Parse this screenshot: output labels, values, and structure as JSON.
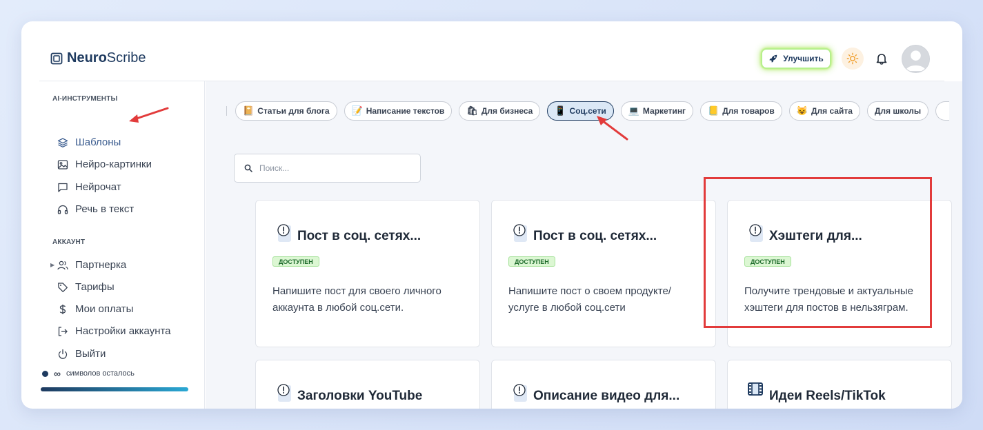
{
  "logo": {
    "bold": "Neuro",
    "rest": "Scribe"
  },
  "header": {
    "upgrade_label": "Улучшить",
    "glow_color": "#b6f08c"
  },
  "sidebar": {
    "section_tools": "AI-ИНСТРУМЕНТЫ",
    "tools": [
      {
        "label": "Шаблоны",
        "icon": "layers-icon",
        "active": true
      },
      {
        "label": "Нейро-картинки",
        "icon": "image-icon"
      },
      {
        "label": "Нейрочат",
        "icon": "chat-icon"
      },
      {
        "label": "Речь в текст",
        "icon": "headphones-icon"
      }
    ],
    "section_account": "АККАУНТ",
    "account": [
      {
        "label": "Партнерка",
        "icon": "users-icon",
        "expandable": true
      },
      {
        "label": "Тарифы",
        "icon": "tag-icon"
      },
      {
        "label": "Мои оплаты",
        "icon": "dollar-icon"
      },
      {
        "label": "Настройки аккаунта",
        "icon": "logout-icon"
      },
      {
        "label": "Выйти",
        "icon": "power-icon"
      }
    ],
    "credits_value": "∞",
    "credits_label": "символов осталось"
  },
  "categories": [
    {
      "label": "Статьи для блога",
      "emoji": "📔"
    },
    {
      "label": "Написание текстов",
      "emoji": "📝"
    },
    {
      "label": "Для бизнеса",
      "emoji": "🛍"
    },
    {
      "label": "Соц.сети",
      "emoji": "📱",
      "active": true
    },
    {
      "label": "Маркетинг",
      "emoji": "💻"
    },
    {
      "label": "Для товаров",
      "emoji": "📒"
    },
    {
      "label": "Для сайта",
      "emoji": "😺"
    },
    {
      "label": "Для школы",
      "emoji": ""
    }
  ],
  "search": {
    "placeholder": "Поиск..."
  },
  "cards": [
    {
      "title": "Пост в соц. сетях...",
      "badge": "ДОСТУПЕН",
      "description": "Напишите пост для своего личного аккаунта в любой соц.сети.",
      "icon": "idea-icon"
    },
    {
      "title": "Пост в соц. сетях...",
      "badge": "ДОСТУПЕН",
      "description": "Напишите пост о своем продукте/ услуге в любой соц.сети",
      "icon": "idea-icon"
    },
    {
      "title": "Хэштеги для...",
      "badge": "ДОСТУПЕН",
      "description": "Получите трендовые и актуальные хэштеги для постов в нельзяграм.",
      "icon": "idea-icon",
      "highlighted": true
    },
    {
      "title": "Заголовки YouTube",
      "badge": "",
      "description": "",
      "icon": "idea-icon"
    },
    {
      "title": "Описание видео для...",
      "badge": "",
      "description": "",
      "icon": "idea-icon"
    },
    {
      "title": "Идеи Reels/TikTok",
      "badge": "",
      "description": "",
      "icon": "film-icon"
    }
  ],
  "annotation_color": "#e23b3b",
  "active_chip_color": "#1e3a5f",
  "badge_color": "#dcf7d3"
}
